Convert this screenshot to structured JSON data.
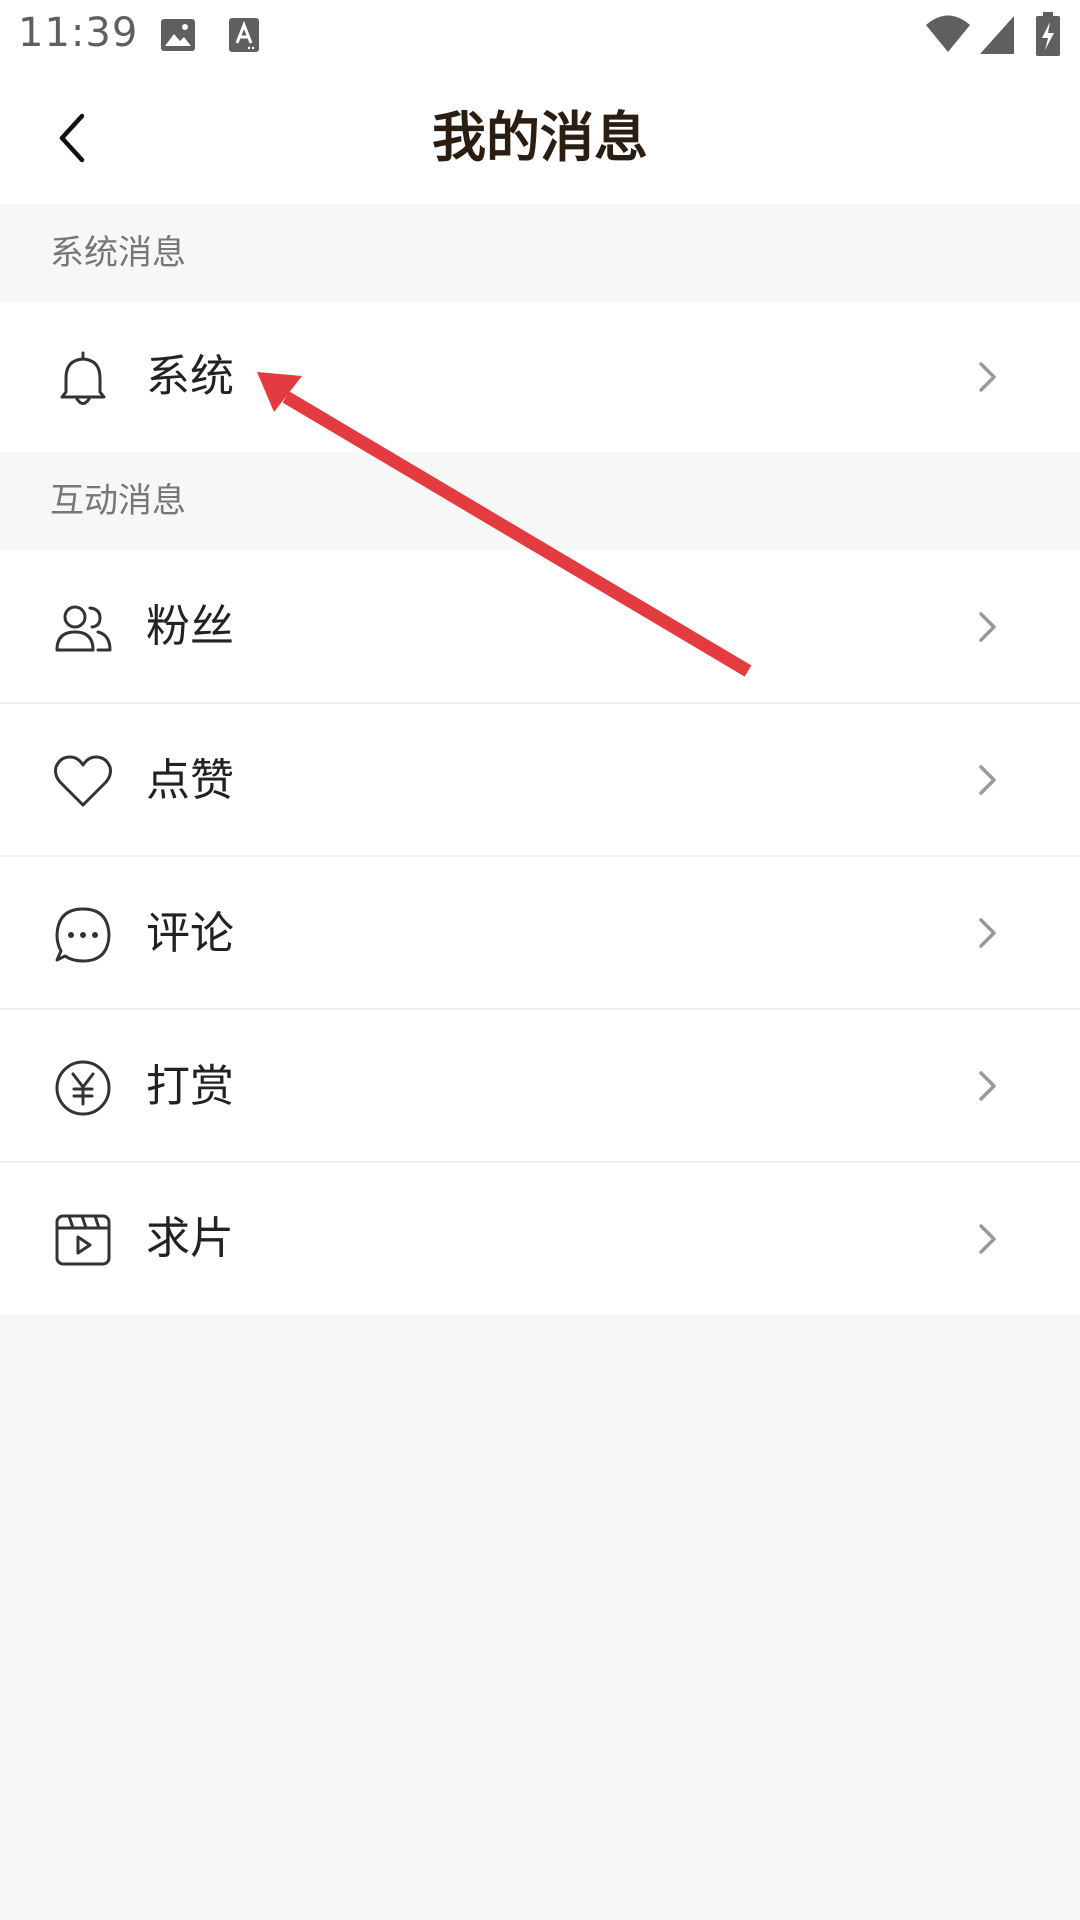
{
  "status_bar": {
    "time": "11:39",
    "icons": [
      "image-icon",
      "text-a-icon",
      "wifi-icon",
      "cellular-signal-icon",
      "battery-charging-icon"
    ]
  },
  "app_bar": {
    "title": "我的消息",
    "back_icon": "back-arrow-icon"
  },
  "sections": {
    "system": {
      "header": "系统消息",
      "items": [
        {
          "label": "系统",
          "icon": "bell-icon"
        }
      ]
    },
    "interaction": {
      "header": "互动消息",
      "items": [
        {
          "label": "粉丝",
          "icon": "fans-icon"
        },
        {
          "label": "点赞",
          "icon": "heart-icon"
        },
        {
          "label": "评论",
          "icon": "comment-icon"
        },
        {
          "label": "打赏",
          "icon": "yuan-coin-icon"
        },
        {
          "label": "求片",
          "icon": "video-request-icon"
        }
      ]
    }
  },
  "colors": {
    "background": "#f6f7f7",
    "row_background": "#ffffff",
    "title_text": "#2a1e12",
    "section_text": "#777777",
    "row_text": "#222222",
    "chevron": "#999999",
    "annotation_arrow": "#e33b3f"
  }
}
